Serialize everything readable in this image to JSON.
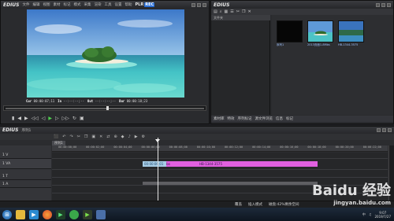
{
  "recorder": {
    "app_logo": "EDIUS",
    "menu": [
      "文件",
      "编辑",
      "视图",
      "素材",
      "标记",
      "模式",
      "采集",
      "渲染",
      "工具",
      "设置",
      "帮助"
    ],
    "plr_label": "PLR",
    "rec_label": "REC",
    "timecodes": {
      "cur_label": "Cur",
      "cur_value": "00:00:07;11",
      "in_label": "In",
      "in_value": "--:--:--;--",
      "out_label": "Out",
      "out_value": "--:--:--;--",
      "dur_label": "Dur",
      "dur_value": "00:00:18;23"
    },
    "transport_glyphs": [
      "▮",
      "◀",
      "▶",
      "◁◁",
      "◁",
      "▶",
      "▷",
      "▷▷",
      "↻",
      "▣"
    ]
  },
  "bin": {
    "app_logo": "EDIUS",
    "header_icons": [
      "folder-icon",
      "search-icon",
      "grid-icon",
      "list-icon"
    ],
    "tree_header": "文件夹",
    "items": [
      {
        "label": "序列1",
        "kind": "sequence"
      },
      {
        "label": "2013页面1-8Mbs",
        "kind": "clip"
      },
      {
        "label": "HB-1344-3575",
        "kind": "clip"
      }
    ],
    "tabs": [
      "素材库",
      "特效",
      "序列标记",
      "源文件浏览",
      "信息",
      "标记"
    ]
  },
  "timeline": {
    "app_logo": "EDIUS",
    "sequence_label": "序列1",
    "sequence_tab": "序列1",
    "ruler_ticks": [
      "00:00:00;00",
      "00:00:02;00",
      "00:00:04;00",
      "00:00:06;00",
      "00:00:08;00",
      "00:00:10;00",
      "00:00:12;00",
      "00:00:14;00",
      "00:00:16;00",
      "00:00:18;00",
      "00:00:20;00",
      "00:00:22;00"
    ],
    "tracks": [
      {
        "name": "1 V",
        "kind": "video"
      },
      {
        "name": "1 VA",
        "kind": "va"
      },
      {
        "name": "1 T",
        "kind": "title"
      },
      {
        "name": "1 A",
        "kind": "audio"
      }
    ],
    "clips": [
      {
        "label": "2013页面1-8Mbs",
        "start": 6.5,
        "end": 10.4,
        "color": "#e160e0"
      },
      {
        "label": "HB-1344-3575",
        "start": 10.4,
        "end": 19.0,
        "color": "#e160e0"
      }
    ],
    "clip_hint": "00:00:06;01",
    "playhead_time": 7.4,
    "status": {
      "mode": "覆盖",
      "insert": "插入模式",
      "disk": "磁盘:42%剩余空间"
    }
  },
  "taskbar": {
    "start_icon": "windows-start-icon",
    "apps": [
      "folder-icon",
      "media-player-icon",
      "firefox-icon",
      "edius-icon",
      "360-icon",
      "media-icon",
      "unknown-app-icon"
    ],
    "time": "9:07",
    "date": "2019/7/27",
    "lang": "中"
  },
  "watermark": {
    "brand": "Baidu 经验",
    "url": "jingyan.baidu.com"
  }
}
